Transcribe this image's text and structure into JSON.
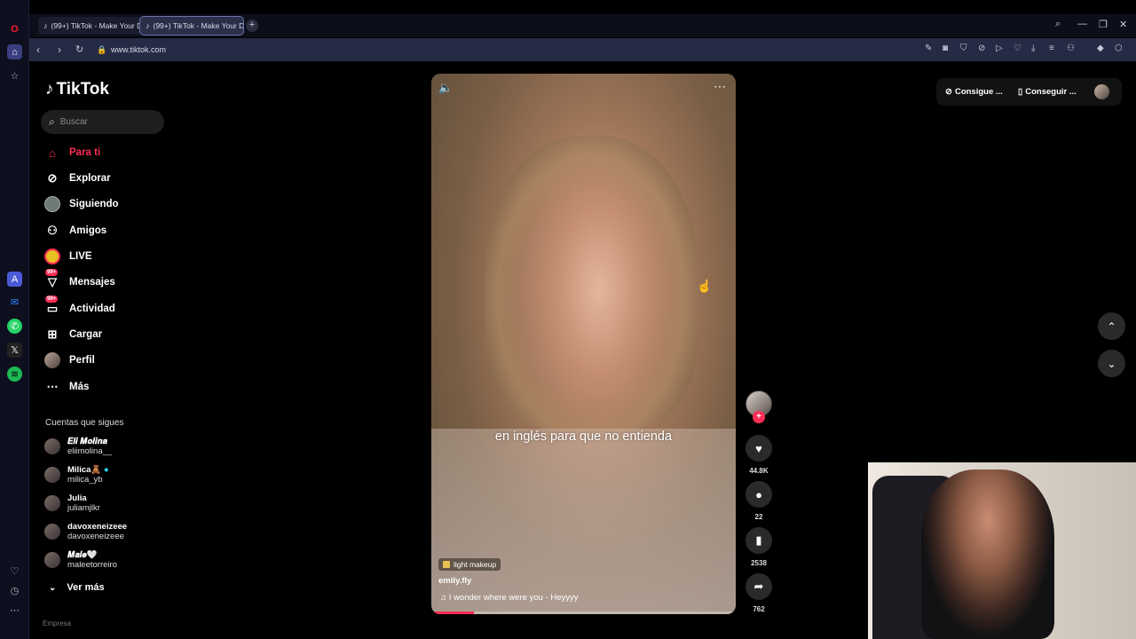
{
  "browser": {
    "tabs": [
      {
        "label": "(99+) TikTok - Make Your Day"
      },
      {
        "label": "(99+) TikTok - Make Your Day"
      }
    ],
    "url": "www.tiktok.com"
  },
  "sidebar": {
    "logo": "TikTok",
    "search_placeholder": "Buscar",
    "nav": [
      {
        "label": "Para ti",
        "icon": "home-icon"
      },
      {
        "label": "Explorar",
        "icon": "compass-icon"
      },
      {
        "label": "Siguiendo",
        "icon": "following-avatar-icon"
      },
      {
        "label": "Amigos",
        "icon": "friends-icon"
      },
      {
        "label": "LIVE",
        "icon": "live-icon"
      },
      {
        "label": "Mensajes",
        "icon": "messages-icon",
        "badge": "99+"
      },
      {
        "label": "Actividad",
        "icon": "activity-icon",
        "badge": "99+"
      },
      {
        "label": "Cargar",
        "icon": "upload-icon"
      },
      {
        "label": "Perfil",
        "icon": "profile-avatar-icon"
      },
      {
        "label": "Más",
        "icon": "more-icon"
      }
    ],
    "following_title": "Cuentas que sigues",
    "following": [
      {
        "name": "𝑬𝒍𝒊 𝑴𝒐𝒍𝒊𝒏𝒂",
        "user": "eliimolina__"
      },
      {
        "name": "Milica🧸",
        "user": "milica_yb"
      },
      {
        "name": "Julia",
        "user": "juliamjlkr"
      },
      {
        "name": "davoxeneizeee",
        "user": "davoxeneizeee"
      },
      {
        "name": "𝑴𝒂𝒍𝒆🤍",
        "user": "maleetorreiro"
      }
    ],
    "see_more": "Ver más",
    "footer": "Empresa"
  },
  "video": {
    "caption": "en inglés para que no entienda",
    "effect": "light makeup",
    "username": "emily.fly",
    "music": "I wonder where were you - Heyyyy",
    "progress": 0.14
  },
  "actions": {
    "likes": "44.8K",
    "comments": "22",
    "saves": "2538",
    "shares": "762"
  },
  "topbar": {
    "coins_label": "Consigue ...",
    "app_label": "Conseguir ..."
  },
  "colors": {
    "accent": "#fe2c55"
  }
}
